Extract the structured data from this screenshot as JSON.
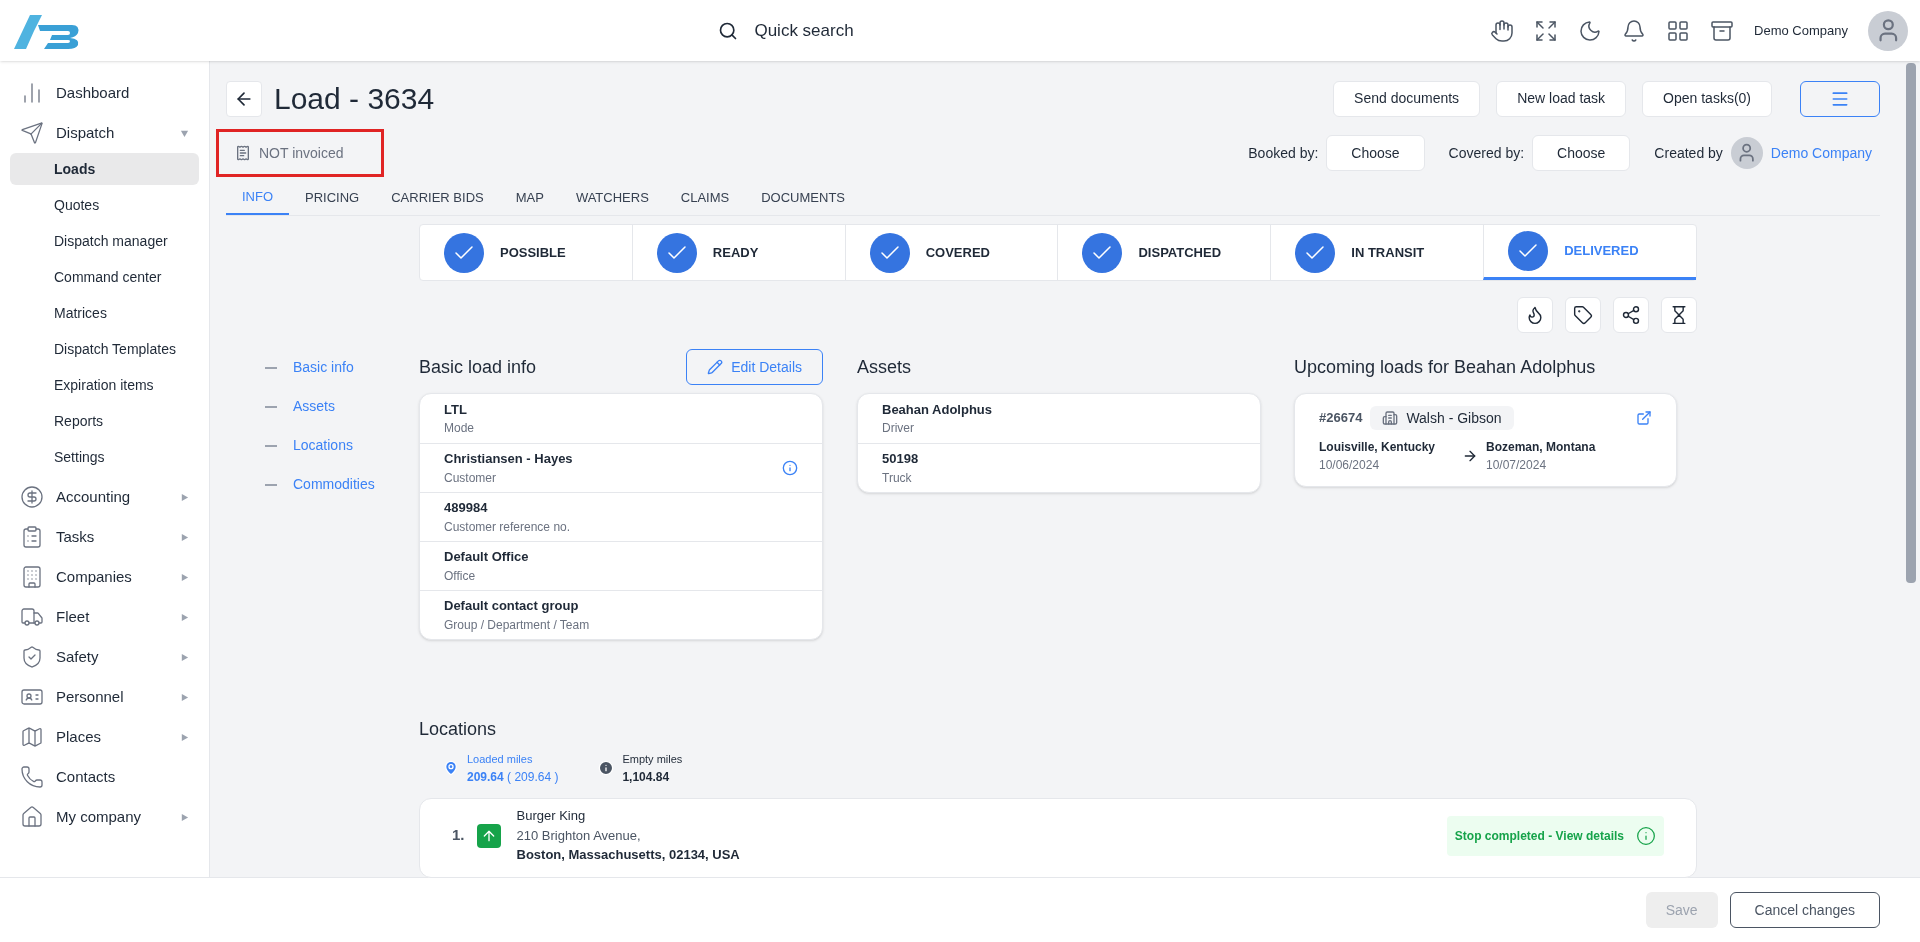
{
  "header": {
    "search_label": "Quick search",
    "company": "Demo Company"
  },
  "sidebar": {
    "items": [
      {
        "label": "Dashboard",
        "has_arrow": false,
        "selected": false
      },
      {
        "label": "Dispatch",
        "has_arrow": true,
        "expanded": true,
        "selected": false,
        "children": [
          {
            "label": "Loads",
            "selected": true
          },
          {
            "label": "Quotes",
            "selected": false
          },
          {
            "label": "Dispatch manager",
            "selected": false
          },
          {
            "label": "Command center",
            "selected": false
          },
          {
            "label": "Matrices",
            "selected": false
          },
          {
            "label": "Dispatch Templates",
            "selected": false
          },
          {
            "label": "Expiration items",
            "selected": false
          },
          {
            "label": "Reports",
            "selected": false
          },
          {
            "label": "Settings",
            "selected": false
          }
        ]
      },
      {
        "label": "Accounting",
        "has_arrow": true,
        "expanded": false,
        "selected": false
      },
      {
        "label": "Tasks",
        "has_arrow": true,
        "expanded": false,
        "selected": false
      },
      {
        "label": "Companies",
        "has_arrow": true,
        "expanded": false,
        "selected": false
      },
      {
        "label": "Fleet",
        "has_arrow": true,
        "expanded": false,
        "selected": false
      },
      {
        "label": "Safety",
        "has_arrow": true,
        "expanded": false,
        "selected": false
      },
      {
        "label": "Personnel",
        "has_arrow": true,
        "expanded": false,
        "selected": false
      },
      {
        "label": "Places",
        "has_arrow": true,
        "expanded": false,
        "selected": false
      },
      {
        "label": "Contacts",
        "has_arrow": false,
        "selected": false
      },
      {
        "label": "My company",
        "has_arrow": true,
        "expanded": false,
        "selected": false
      }
    ]
  },
  "page": {
    "title": "Load - 3634",
    "invoice_status": "NOT invoiced",
    "actions": [
      "Send documents",
      "New load task",
      "Open tasks(0)"
    ],
    "booked_by": {
      "label": "Booked by:",
      "value": "Choose"
    },
    "covered_by": {
      "label": "Covered by:",
      "value": "Choose"
    },
    "created_by": {
      "label": "Created by",
      "name": "Demo Company"
    }
  },
  "tabs": [
    {
      "label": "INFO",
      "selected": true
    },
    {
      "label": "PRICING",
      "selected": false
    },
    {
      "label": "CARRIER BIDS",
      "selected": false
    },
    {
      "label": "MAP",
      "selected": false
    },
    {
      "label": "WATCHERS",
      "selected": false
    },
    {
      "label": "CLAIMS",
      "selected": false
    },
    {
      "label": "DOCUMENTS",
      "selected": false
    }
  ],
  "steps": [
    {
      "label": "POSSIBLE",
      "done": true,
      "selected": false
    },
    {
      "label": "READY",
      "done": true,
      "selected": false
    },
    {
      "label": "COVERED",
      "done": true,
      "selected": false
    },
    {
      "label": "DISPATCHED",
      "done": true,
      "selected": false
    },
    {
      "label": "IN TRANSIT",
      "done": true,
      "selected": false
    },
    {
      "label": "DELIVERED",
      "done": true,
      "selected": true
    }
  ],
  "anchors": [
    {
      "label": "Basic info"
    },
    {
      "label": "Assets"
    },
    {
      "label": "Locations"
    },
    {
      "label": "Commodities"
    }
  ],
  "basic_info": {
    "title": "Basic load info",
    "edit_button": "Edit Details",
    "rows": [
      {
        "value": "LTL",
        "label": "Mode",
        "info": false
      },
      {
        "value": "Christiansen - Hayes",
        "label": "Customer",
        "info": true
      },
      {
        "value": "489984",
        "label": "Customer reference no.",
        "info": false
      },
      {
        "value": "Default Office",
        "label": "Office",
        "info": false
      },
      {
        "value": "Default contact group",
        "label": "Group / Department / Team",
        "info": false
      }
    ]
  },
  "assets": {
    "title": "Assets",
    "rows": [
      {
        "value": "Beahan Adolphus",
        "label": "Driver"
      },
      {
        "value": "50198",
        "label": "Truck"
      }
    ]
  },
  "upcoming": {
    "title": "Upcoming loads for Beahan Adolphus",
    "loads": [
      {
        "number": "#26674",
        "company": "Walsh - Gibson",
        "from": "Louisville, Kentucky",
        "from_date": "10/06/2024",
        "to": "Bozeman, Montana",
        "to_date": "10/07/2024"
      }
    ]
  },
  "locations": {
    "title": "Locations",
    "loaded_label": "Loaded miles",
    "loaded_value": "209.64",
    "loaded_extra": "( 209.64 )",
    "empty_label": "Empty miles",
    "empty_value": "1,104.84",
    "stops": [
      {
        "index": "1.",
        "name": "Burger King",
        "street": "210 Brighton Avenue,",
        "city": "Boston, Massachusetts, 02134, USA",
        "status": "Stop completed - View details",
        "completed": true
      }
    ]
  },
  "footer": {
    "save": {
      "label": "Save",
      "disabled": true
    },
    "cancel": {
      "label": "Cancel changes"
    }
  }
}
